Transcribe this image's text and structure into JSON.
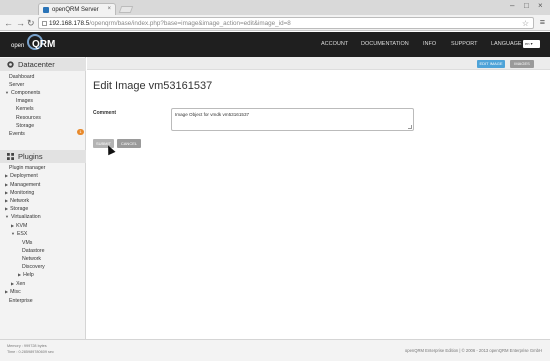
{
  "browser": {
    "tab_title": "openQRM Server",
    "tab_close": "×",
    "url_host": "192.168.178.5",
    "url_path": "/openqrm/base/index.php?base=image&image_action=edit&image_id=8",
    "back_icon": "←",
    "forward_icon": "→",
    "reload_icon": "↻",
    "star_icon": "☆",
    "menu_icon": "≡",
    "win_min": "–",
    "win_max": "□",
    "win_close": "×"
  },
  "logo": {
    "prefix": "open",
    "mark": "QRM"
  },
  "topnav": {
    "items": [
      "ACCOUNT",
      "DOCUMENTATION",
      "INFO",
      "SUPPORT",
      "LANGUAGE"
    ],
    "language_value": "en"
  },
  "sidebar": {
    "datacenter_title": "Datacenter",
    "datacenter_items": [
      {
        "label": "Dashboard"
      },
      {
        "label": "Server"
      },
      {
        "label": "Components",
        "expanded": true
      },
      {
        "label": "Images"
      },
      {
        "label": "Kernels"
      },
      {
        "label": "Resources"
      },
      {
        "label": "Storage"
      },
      {
        "label": "Events",
        "badge": "1"
      }
    ],
    "plugins_title": "Plugins",
    "plugin_items": [
      {
        "label": "Plugin manager"
      },
      {
        "label": "Deployment"
      },
      {
        "label": "Management"
      },
      {
        "label": "Monitoring"
      },
      {
        "label": "Network"
      },
      {
        "label": "Storage"
      },
      {
        "label": "Virtualization"
      },
      {
        "label": "KVM"
      },
      {
        "label": "ESX"
      },
      {
        "label": "VMs"
      },
      {
        "label": "Datastore"
      },
      {
        "label": "Network"
      },
      {
        "label": "Discovery"
      },
      {
        "label": "Help"
      },
      {
        "label": "Xen"
      },
      {
        "label": "Misc"
      },
      {
        "label": "Enterprise"
      }
    ]
  },
  "controls": {
    "edit_image": "EDIT IMAGE",
    "images": "IMAGES"
  },
  "main": {
    "title": "Edit Image vm53161537",
    "comment_label": "Comment",
    "comment_value": "Image Object for vmdk vm53161537",
    "submit_label": "SUBMIT",
    "cancel_label": "CANCEL"
  },
  "footer": {
    "memory": "Memory : 999728 bytes",
    "time": "Time : 0.285989780609 sec",
    "copyright": "openQRM Enterprise Edition | © 2006 - 2013 openQRM Enterprise GmbH"
  },
  "colors": {
    "accent": "#4ea3d8",
    "topnav": "#1f1f1f",
    "badge": "#e8892b",
    "button_gray": "#9a9a9a"
  }
}
